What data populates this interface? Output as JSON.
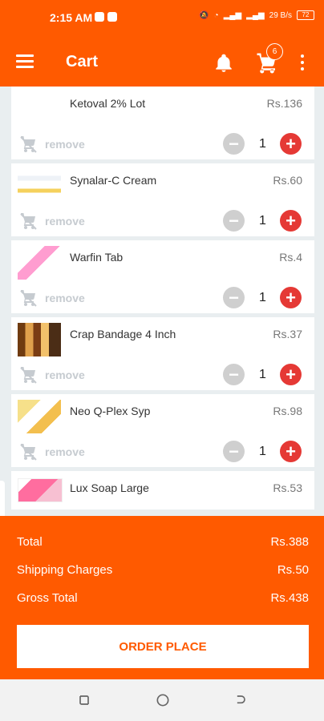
{
  "status": {
    "time": "2:15 AM",
    "speed": "29 B/s",
    "battery": "72"
  },
  "appbar": {
    "title": "Cart",
    "cart_badge": "6"
  },
  "items": [
    {
      "name": "Ketoval 2% Lot",
      "price": "Rs.136",
      "remove": "remove",
      "qty": "1"
    },
    {
      "name": "Synalar-C Cream",
      "price": "Rs.60",
      "remove": "remove",
      "qty": "1"
    },
    {
      "name": "Warfin Tab",
      "price": "Rs.4",
      "remove": "remove",
      "qty": "1"
    },
    {
      "name": "Crap Bandage 4 Inch",
      "price": "Rs.37",
      "remove": "remove",
      "qty": "1"
    },
    {
      "name": "Neo Q-Plex Syp",
      "price": "Rs.98",
      "remove": "remove",
      "qty": "1"
    },
    {
      "name": "Lux Soap Large",
      "price": "Rs.53"
    }
  ],
  "summary": {
    "total_label": "Total",
    "total_value": "Rs.388",
    "shipping_label": "Shipping Charges",
    "shipping_value": "Rs.50",
    "gross_label": "Gross Total",
    "gross_value": "Rs.438",
    "button": "ORDER PLACE"
  },
  "icons": {
    "menu": "menu-icon",
    "bell": "bell-icon",
    "cart": "cart-icon",
    "more": "more-vert-icon",
    "remove": "remove-cart-icon",
    "minus": "minus-icon",
    "plus": "plus-icon"
  },
  "colors": {
    "accent": "#ff5a00",
    "plus": "#e53935",
    "minus": "#cfcfcf"
  }
}
